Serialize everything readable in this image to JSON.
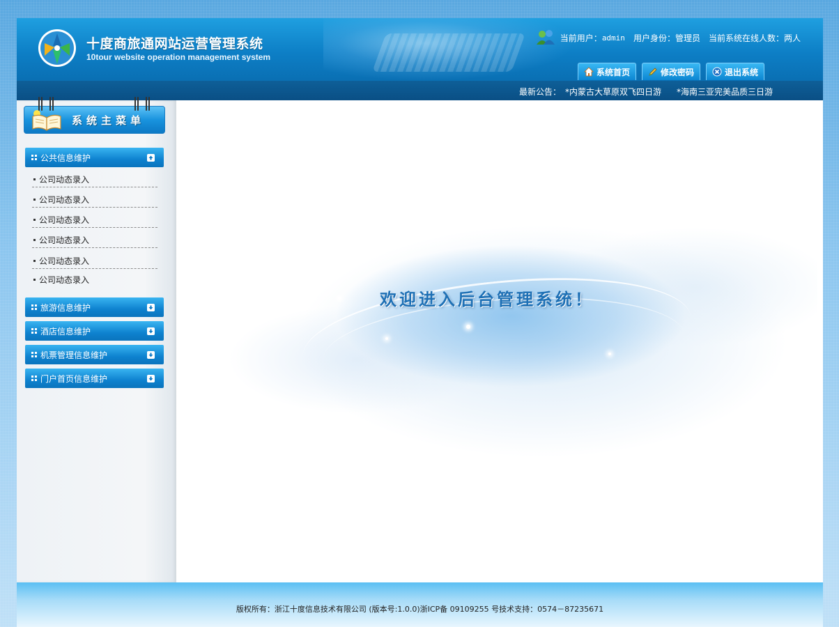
{
  "header": {
    "title": "十度商旅通网站运营管理系统",
    "subtitle": "10tour website operation management system",
    "current_user_label": "当前用户：",
    "current_user": "admin",
    "role_label": "用户身份：",
    "role": "管理员",
    "online_label": "当前系统在线人数：",
    "online_count": "两人",
    "buttons": {
      "home": "系统首页",
      "change_password": "修改密码",
      "logout": "退出系统"
    }
  },
  "notice": {
    "label": "最新公告：",
    "items": [
      "*内蒙古大草原双飞四日游",
      "*海南三亚完美品质三日游"
    ]
  },
  "sidebar": {
    "menu_title": "系统主菜单",
    "sections": [
      {
        "label": "公共信息维护",
        "expanded": true,
        "items": [
          "公司动态录入",
          "公司动态录入",
          "公司动态录入",
          "公司动态录入",
          "公司动态录入",
          "公司动态录入"
        ]
      },
      {
        "label": "旅游信息维护",
        "expanded": false
      },
      {
        "label": "酒店信息维护",
        "expanded": false
      },
      {
        "label": "机票管理信息维护",
        "expanded": false
      },
      {
        "label": "门户首页信息维护",
        "expanded": false
      }
    ]
  },
  "main": {
    "welcome": "欢迎进入后台管理系统！"
  },
  "footer": {
    "copyright": "版权所有：浙江十度信息技术有限公司 (版本号:1.0.0)浙ICP备 09109255 号技术支持：0574－87235671"
  },
  "colors": {
    "header_blue": "#0d7fc6",
    "section_blue": "#0e82cf",
    "welcome_text": "#1e70b5"
  }
}
